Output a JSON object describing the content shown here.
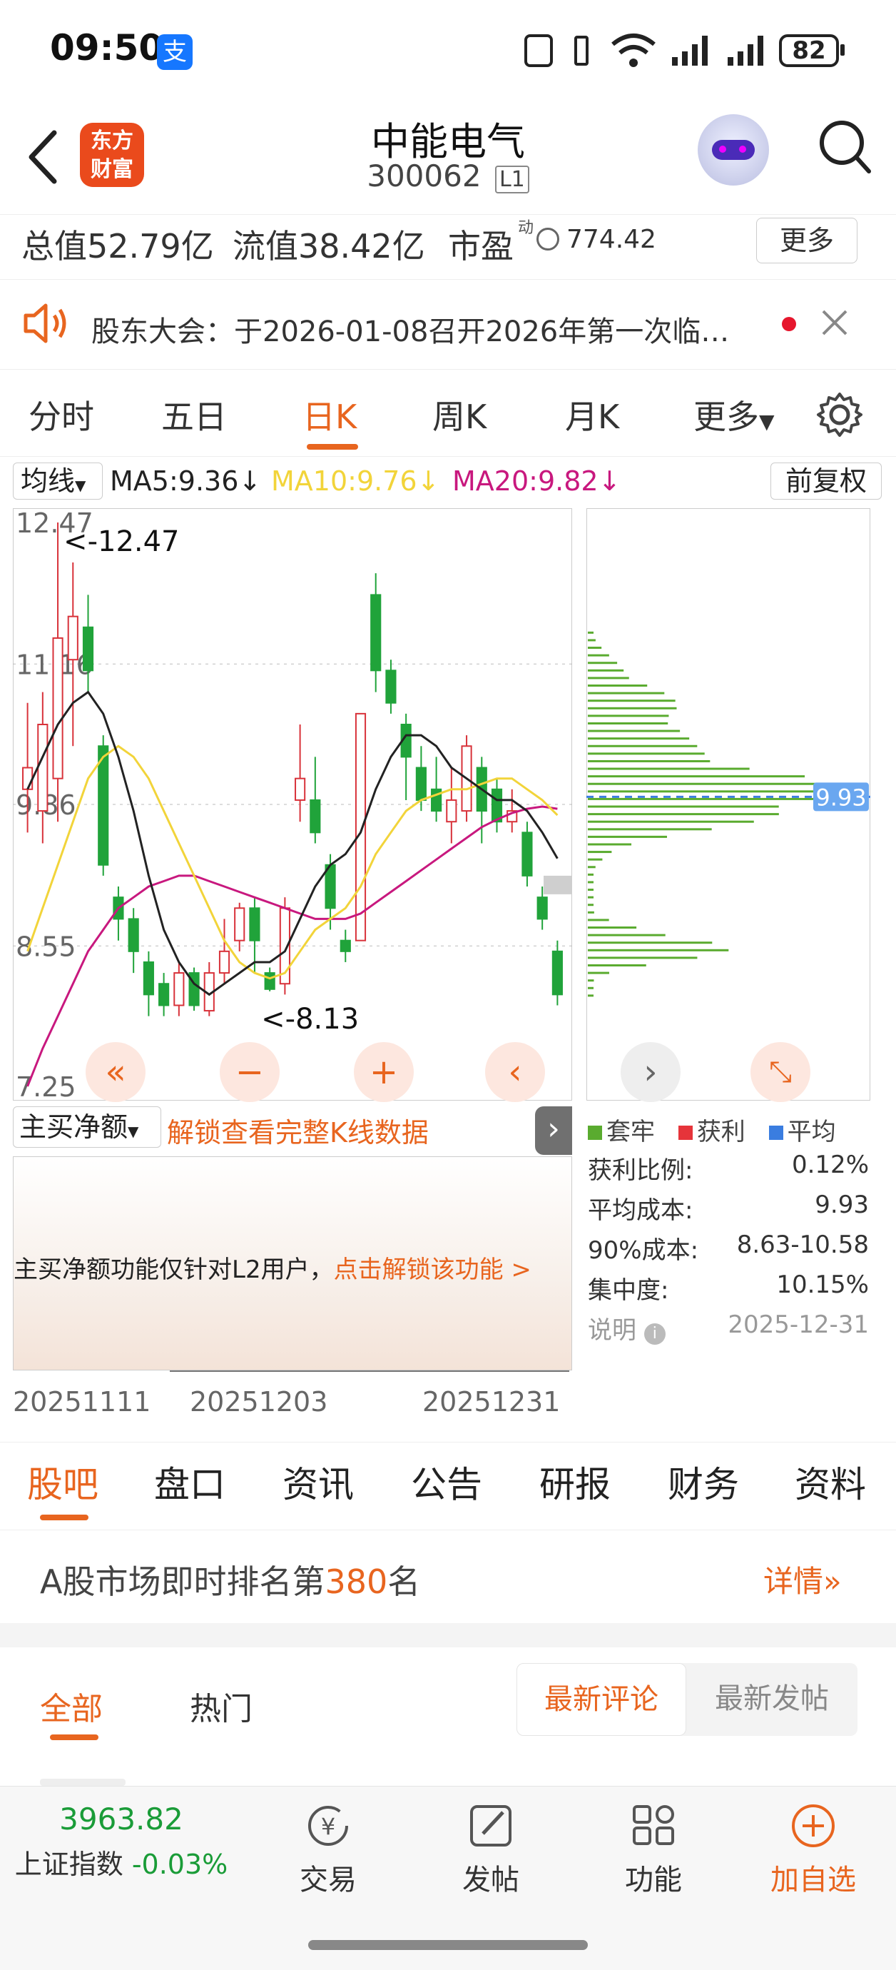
{
  "status_bar": {
    "time": "09:50",
    "alipay_icon": "支",
    "battery": "82"
  },
  "header": {
    "title": "中能电气",
    "code": "300062",
    "level": "L1",
    "logo_text_1": "东方",
    "logo_text_2": "财富"
  },
  "stats": {
    "total_value": "总值52.79亿",
    "float_value": "流值38.42亿",
    "pe_label": "市盈",
    "pe_sup": "动",
    "pe_value": "774.42",
    "more": "更多"
  },
  "notice": {
    "text": "股东大会：于2026-01-08召开2026年第一次临…"
  },
  "chart_tabs": [
    "分时",
    "五日",
    "日K",
    "周K",
    "月K",
    "更多"
  ],
  "active_tab": "日K",
  "ma_bar": {
    "selector": "均线",
    "ma5": "MA5:9.36",
    "ma10": "MA10:9.76",
    "ma20": "MA20:9.82",
    "adjust": "前复权",
    "ma5_color": "#222222",
    "ma10_color": "#f2d43a",
    "ma20_color": "#c8187e"
  },
  "chart_data": {
    "type": "candlestick",
    "y_ticks": [
      "12.47",
      "11.16",
      "9.86",
      "8.55",
      "7.25"
    ],
    "ylim": [
      7.25,
      12.47
    ],
    "high_label": "<-12.47",
    "low_label": "<-8.13",
    "x_ticks": [
      "20251111",
      "20251203",
      "20251231"
    ],
    "candles": [
      {
        "o": 10.0,
        "c": 10.2,
        "h": 10.8,
        "l": 9.6
      },
      {
        "o": 9.8,
        "c": 10.6,
        "h": 10.9,
        "l": 9.5
      },
      {
        "o": 10.1,
        "c": 11.4,
        "h": 12.47,
        "l": 9.7
      },
      {
        "o": 11.2,
        "c": 11.6,
        "h": 12.1,
        "l": 10.4
      },
      {
        "o": 11.5,
        "c": 11.1,
        "h": 11.8,
        "l": 10.9
      },
      {
        "o": 10.4,
        "c": 9.3,
        "h": 10.5,
        "l": 9.2
      },
      {
        "o": 9.0,
        "c": 8.8,
        "h": 9.1,
        "l": 8.6
      },
      {
        "o": 8.8,
        "c": 8.5,
        "h": 8.9,
        "l": 8.3
      },
      {
        "o": 8.4,
        "c": 8.1,
        "h": 8.5,
        "l": 7.9
      },
      {
        "o": 8.2,
        "c": 8.0,
        "h": 8.3,
        "l": 7.9
      },
      {
        "o": 8.0,
        "c": 8.3,
        "h": 8.4,
        "l": 7.9
      },
      {
        "o": 8.3,
        "c": 8.0,
        "h": 8.35,
        "l": 7.95
      },
      {
        "o": 7.95,
        "c": 8.3,
        "h": 8.4,
        "l": 7.9
      },
      {
        "o": 8.3,
        "c": 8.5,
        "h": 8.8,
        "l": 8.2
      },
      {
        "o": 8.6,
        "c": 8.9,
        "h": 8.95,
        "l": 8.5
      },
      {
        "o": 8.9,
        "c": 8.6,
        "h": 9.0,
        "l": 8.3
      },
      {
        "o": 8.3,
        "c": 8.15,
        "h": 8.35,
        "l": 8.13
      },
      {
        "o": 8.2,
        "c": 8.9,
        "h": 9.0,
        "l": 8.1
      },
      {
        "o": 9.9,
        "c": 10.1,
        "h": 10.6,
        "l": 9.7
      },
      {
        "o": 9.9,
        "c": 9.6,
        "h": 10.3,
        "l": 9.5
      },
      {
        "o": 9.3,
        "c": 8.9,
        "h": 9.4,
        "l": 8.7
      },
      {
        "o": 8.6,
        "c": 8.5,
        "h": 8.7,
        "l": 8.4
      },
      {
        "o": 8.6,
        "c": 10.7,
        "h": 10.7,
        "l": 8.6
      },
      {
        "o": 11.8,
        "c": 11.1,
        "h": 12.0,
        "l": 10.9
      },
      {
        "o": 11.1,
        "c": 10.8,
        "h": 11.2,
        "l": 10.7
      },
      {
        "o": 10.6,
        "c": 10.3,
        "h": 10.7,
        "l": 9.9
      },
      {
        "o": 10.2,
        "c": 9.9,
        "h": 10.4,
        "l": 9.8
      },
      {
        "o": 10.0,
        "c": 9.8,
        "h": 10.3,
        "l": 9.7
      },
      {
        "o": 9.7,
        "c": 9.9,
        "h": 10.2,
        "l": 9.5
      },
      {
        "o": 9.8,
        "c": 10.4,
        "h": 10.5,
        "l": 9.7
      },
      {
        "o": 10.2,
        "c": 9.8,
        "h": 10.3,
        "l": 9.5
      },
      {
        "o": 10.0,
        "c": 9.7,
        "h": 10.1,
        "l": 9.6
      },
      {
        "o": 9.7,
        "c": 9.8,
        "h": 10.0,
        "l": 9.6
      },
      {
        "o": 9.6,
        "c": 9.2,
        "h": 9.7,
        "l": 9.1
      },
      {
        "o": 9.0,
        "c": 8.8,
        "h": 9.1,
        "l": 8.7
      },
      {
        "o": 8.5,
        "c": 8.1,
        "h": 8.6,
        "l": 8.0
      }
    ],
    "ma5": [
      10.0,
      10.3,
      10.6,
      10.8,
      10.9,
      10.7,
      10.3,
      9.8,
      9.2,
      8.7,
      8.4,
      8.2,
      8.1,
      8.2,
      8.3,
      8.4,
      8.4,
      8.5,
      8.8,
      9.1,
      9.3,
      9.4,
      9.6,
      10.0,
      10.3,
      10.5,
      10.5,
      10.4,
      10.2,
      10.1,
      10.0,
      9.9,
      9.9,
      9.8,
      9.6,
      9.36
    ],
    "ma10": [
      8.5,
      8.9,
      9.3,
      9.7,
      10.1,
      10.3,
      10.4,
      10.3,
      10.1,
      9.8,
      9.5,
      9.2,
      8.9,
      8.6,
      8.4,
      8.3,
      8.25,
      8.3,
      8.5,
      8.7,
      8.8,
      8.9,
      9.1,
      9.4,
      9.6,
      9.8,
      9.9,
      9.95,
      10.0,
      10.0,
      10.05,
      10.1,
      10.1,
      10.0,
      9.9,
      9.76
    ],
    "ma20": [
      7.25,
      7.6,
      7.9,
      8.2,
      8.5,
      8.7,
      8.9,
      9.0,
      9.1,
      9.15,
      9.2,
      9.2,
      9.15,
      9.1,
      9.05,
      9.0,
      8.95,
      8.9,
      8.85,
      8.8,
      8.8,
      8.8,
      8.85,
      8.95,
      9.05,
      9.15,
      9.25,
      9.35,
      9.45,
      9.55,
      9.65,
      9.72,
      9.78,
      9.82,
      9.84,
      9.82
    ],
    "cost_profile_price": "9.93"
  },
  "indicator": {
    "selector": "主买净额",
    "unlock_link": "解锁查看完整K线数据",
    "notice": "主买净额功能仅针对L2用户，",
    "notice_link": "点击解锁该功能 >"
  },
  "cost_legend": {
    "trapped": "套牢",
    "profit": "获利",
    "average": "平均"
  },
  "cost_stats": [
    {
      "label": "获利比例:",
      "value": "0.12%"
    },
    {
      "label": "平均成本:",
      "value": "9.93"
    },
    {
      "label": "90%成本:",
      "value": "8.63-10.58"
    },
    {
      "label": "集中度:",
      "value": "10.15%"
    }
  ],
  "cost_note": {
    "label": "说明",
    "date": "2025-12-31"
  },
  "section_tabs": [
    "股吧",
    "盘口",
    "资讯",
    "公告",
    "研报",
    "财务",
    "资料"
  ],
  "ranking": {
    "prefix": "A股市场即时排名第",
    "rank": "380",
    "suffix": "名",
    "detail": "详情"
  },
  "forum_tabs": {
    "all": "全部",
    "hot": "热门",
    "latest_comment": "最新评论",
    "latest_post": "最新发帖"
  },
  "bottom_bar": {
    "index_value": "3963.82",
    "index_name": "上证指数",
    "index_change": "-0.03%",
    "trade": "交易",
    "post": "发帖",
    "func": "功能",
    "add": "加自选"
  }
}
